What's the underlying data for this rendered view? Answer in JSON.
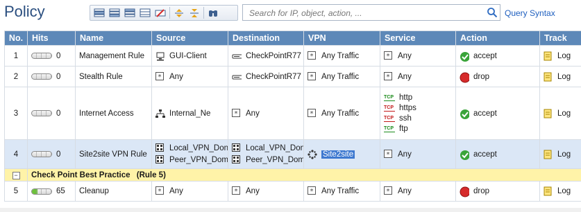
{
  "page_title": "Policy",
  "toolbar": {
    "buttons": [
      "add-rule-above-icon",
      "add-rule-below-icon",
      "add-rule-top-icon",
      "add-rule-bottom-icon",
      "delete-rule-icon",
      "move-up-icon",
      "move-down-icon",
      "find-icon"
    ]
  },
  "search": {
    "placeholder": "Search for IP, object, action, ...",
    "value": ""
  },
  "query_syntax_label": "Query Syntax",
  "columns": [
    "No.",
    "Hits",
    "Name",
    "Source",
    "Destination",
    "VPN",
    "Service",
    "Action",
    "Track"
  ],
  "rules": [
    {
      "no": "1",
      "hits": "0",
      "hits_fraction": 0,
      "name": "Management Rule",
      "source": [
        "GUI-Client"
      ],
      "source_icon": "host-icon",
      "destination": [
        "CheckPointR77"
      ],
      "destination_icon": "gateway-icon",
      "vpn": "Any Traffic",
      "vpn_icon": "any-icon",
      "service": [
        "Any"
      ],
      "action": "accept",
      "track": "Log"
    },
    {
      "no": "2",
      "hits": "0",
      "hits_fraction": 0,
      "name": "Stealth Rule",
      "source": [
        "Any"
      ],
      "source_icon": "any-icon",
      "destination": [
        "CheckPointR77"
      ],
      "destination_icon": "gateway-icon",
      "vpn": "Any Traffic",
      "vpn_icon": "any-icon",
      "service": [
        "Any"
      ],
      "action": "drop",
      "track": "Log"
    },
    {
      "no": "3",
      "hits": "0",
      "hits_fraction": 0,
      "name": "Internet Access",
      "source": [
        "Internal_Ne"
      ],
      "source_icon": "network-icon",
      "destination": [
        "Any"
      ],
      "destination_icon": "any-icon",
      "vpn": "Any Traffic",
      "vpn_icon": "any-icon",
      "service": [
        "http",
        "https",
        "ssh",
        "ftp"
      ],
      "action": "accept",
      "track": "Log"
    },
    {
      "no": "4",
      "hits": "0",
      "hits_fraction": 0,
      "name": "Site2site VPN Rule",
      "source": [
        "Local_VPN_Don",
        "Peer_VPN_Dom"
      ],
      "source_icon": "domain-icon",
      "destination": [
        "Local_VPN_Don",
        "Peer_VPN_Dom"
      ],
      "destination_icon": "domain-icon",
      "vpn": "Site2site",
      "vpn_icon": "vpn-community-icon",
      "service": [
        "Any"
      ],
      "action": "accept",
      "track": "Log"
    }
  ],
  "section": {
    "title": "Check Point Best Practice",
    "range": "(Rule 5)"
  },
  "last_rule": {
    "no": "5",
    "hits": "65",
    "hits_fraction": 0.3,
    "name": "Cleanup",
    "source": [
      "Any"
    ],
    "destination": [
      "Any"
    ],
    "vpn": "Any Traffic",
    "service": [
      "Any"
    ],
    "action": "drop",
    "track": "Log"
  },
  "colors": {
    "header_bg": "#5d88b8",
    "selected_row": "#dbe7f6",
    "section_bg": "#fff3a8",
    "accept": "#3aa43a",
    "drop": "#d62b2b",
    "tcp_green": "#1a8a1a",
    "tcp_red": "#c21818"
  }
}
